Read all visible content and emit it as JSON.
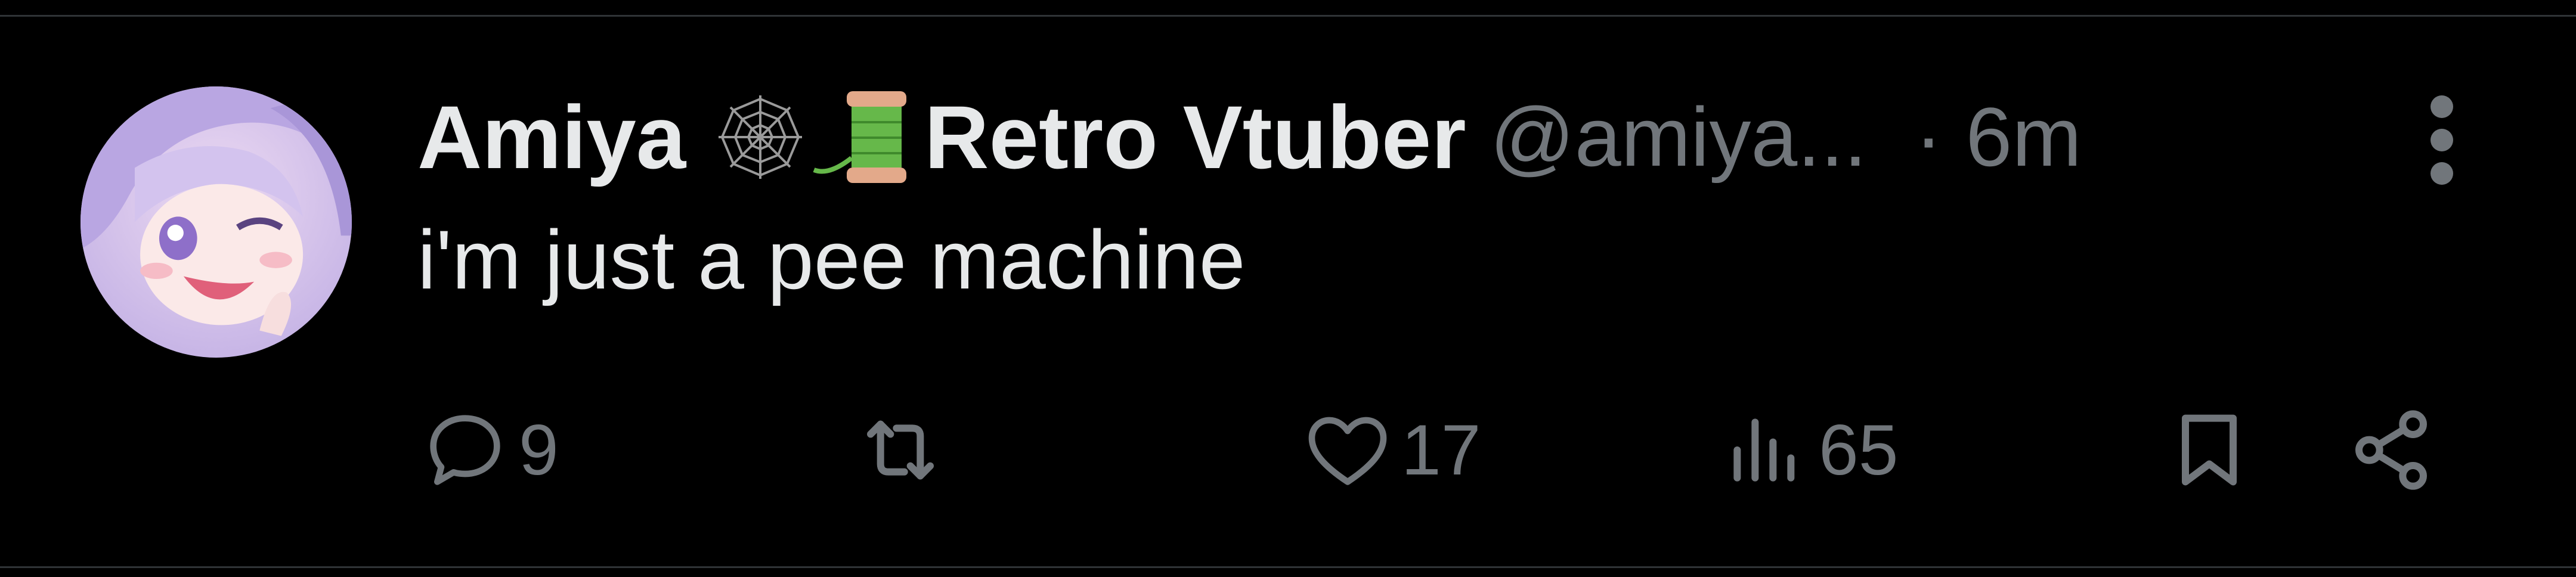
{
  "tweet": {
    "display_name": "Amiya",
    "name_emojis": [
      "spider-web-icon",
      "thread-spool-icon"
    ],
    "display_name_suffix": "Retro Vtuber",
    "handle": "@amiya...",
    "time": "· 6m",
    "text": "i'm just a pee machine"
  },
  "actions": {
    "reply_count": "9",
    "repost_count": "",
    "like_count": "17",
    "views_count": "65"
  },
  "colors": {
    "background": "#000000",
    "primary_text": "#e7e9ea",
    "secondary_text": "#71767b",
    "divider": "#2f3336"
  }
}
